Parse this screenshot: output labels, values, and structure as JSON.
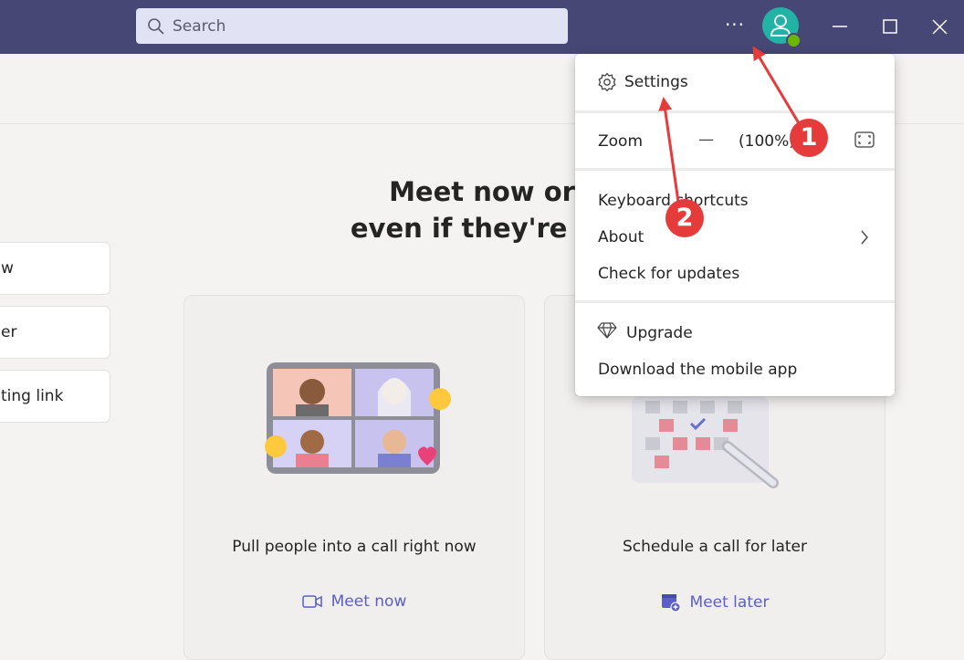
{
  "titlebar": {
    "search_placeholder": "Search",
    "more_label": "···"
  },
  "main": {
    "heading_line1": "Meet now or",
    "heading_line2": "even if they're no",
    "left_buttons": [
      "w",
      "er",
      "ting link"
    ],
    "cards": [
      {
        "title": "Pull people into a call right now",
        "action": "Meet now",
        "icon": "video-camera-icon"
      },
      {
        "title": "Schedule a call for later",
        "action": "Meet later",
        "icon": "calendar-add-icon"
      }
    ]
  },
  "menu": {
    "settings": "Settings",
    "zoom_label": "Zoom",
    "zoom_minus": "—",
    "zoom_value": "(100%)",
    "keyboard_shortcuts": "Keyboard shortcuts",
    "about": "About",
    "check_updates": "Check for updates",
    "upgrade": "Upgrade",
    "download_app": "Download the mobile app"
  },
  "annotations": {
    "badge1": "1",
    "badge2": "2"
  },
  "colors": {
    "titlebar": "#464775",
    "accent": "#5b5fc7",
    "annotation": "#e53b3b"
  }
}
